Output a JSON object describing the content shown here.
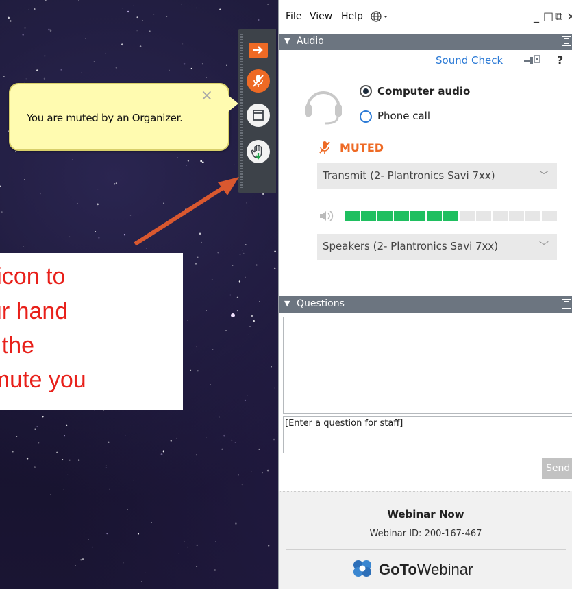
{
  "tooltip": {
    "message": "You are muted by an Organizer.",
    "close": "×"
  },
  "callout": {
    "lines": [
      "he icon to",
      " your hand",
      "est the",
      "unmute you"
    ]
  },
  "menu": {
    "file": "File",
    "view": "View",
    "help": "Help"
  },
  "window_controls": {
    "minimize": "_",
    "restore": "□",
    "popout": "⧉",
    "close": "×"
  },
  "audio": {
    "header": "Audio",
    "sound_check": "Sound Check",
    "help": "?",
    "option_computer": "Computer audio",
    "option_phone": "Phone call",
    "selected": "Computer audio",
    "status": "MUTED",
    "transmit": "Transmit (2- Plantronics Savi 7xx)",
    "speakers": "Speakers (2- Plantronics Savi 7xx)",
    "level_segments_on": 7,
    "level_segments_total": 13,
    "accent": "#ee6a25",
    "meter_on": "#1fbf60",
    "meter_off": "#e6e6e6"
  },
  "questions": {
    "header": "Questions",
    "placeholder": "[Enter a question for staff]",
    "send": "Send"
  },
  "footer": {
    "title": "Webinar Now",
    "webinar_id": "Webinar ID: 200-167-467",
    "brand_bold": "GoTo",
    "brand_rest": "Webinar"
  }
}
